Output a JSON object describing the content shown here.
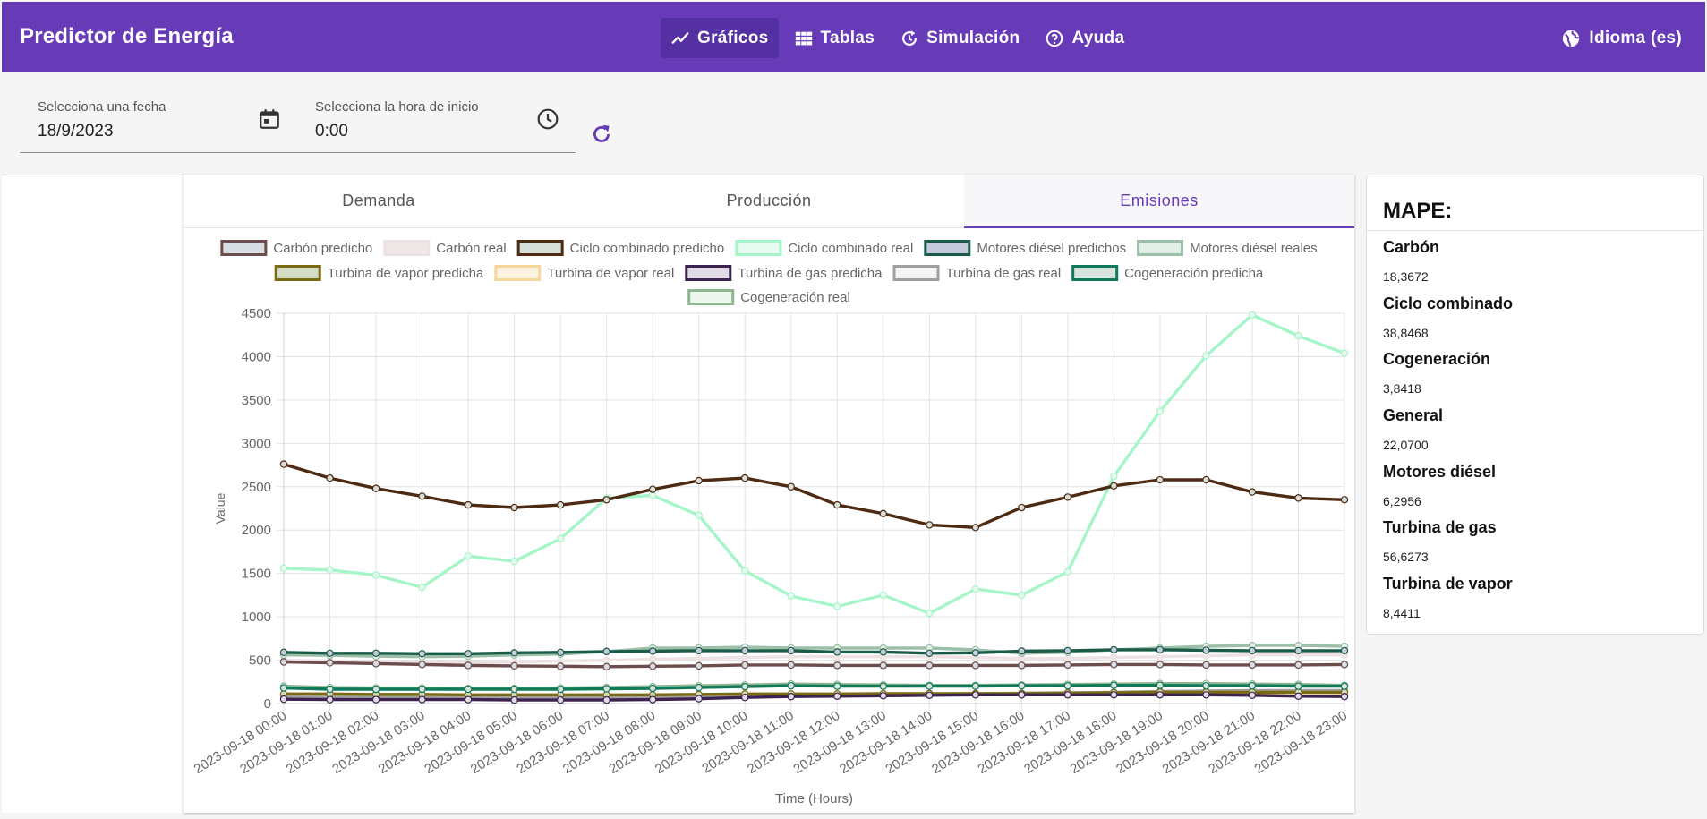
{
  "app": {
    "title": "Predictor de Energía"
  },
  "nav": [
    {
      "label": "Gráficos",
      "icon": "chart-line-icon",
      "active": true
    },
    {
      "label": "Tablas",
      "icon": "table-grid-icon",
      "active": false
    },
    {
      "label": "Simulación",
      "icon": "history-restore-icon",
      "active": false
    },
    {
      "label": "Ayuda",
      "icon": "help-circle-icon",
      "active": false
    }
  ],
  "language": {
    "label": "Idioma (es)",
    "icon": "globe-icon"
  },
  "controls": {
    "date": {
      "label": "Selecciona una fecha",
      "value": "18/9/2023",
      "icon": "calendar-icon"
    },
    "time": {
      "label": "Selecciona la hora de inicio",
      "value": "0:00",
      "icon": "clock-icon"
    },
    "refresh_icon": "refresh-icon"
  },
  "tabs": [
    {
      "label": "Demanda",
      "active": false
    },
    {
      "label": "Producción",
      "active": false
    },
    {
      "label": "Emisiones",
      "active": true
    }
  ],
  "mape": {
    "title": "MAPE:",
    "items": [
      {
        "name": "Carbón",
        "value": "18,3672"
      },
      {
        "name": "Ciclo combinado",
        "value": "38,8468"
      },
      {
        "name": "Cogeneración",
        "value": "3,8418"
      },
      {
        "name": "General",
        "value": "22,0700"
      },
      {
        "name": "Motores diésel",
        "value": "6,2956"
      },
      {
        "name": "Turbina de gas",
        "value": "56,6273"
      },
      {
        "name": "Turbina de vapor",
        "value": "8,4411"
      }
    ]
  },
  "chart_data": {
    "type": "line",
    "xlabel": "Time (Hours)",
    "ylabel": "Value",
    "ylim": [
      0,
      4500
    ],
    "yticks": [
      0,
      500,
      1000,
      1500,
      2000,
      2500,
      3000,
      3500,
      4000,
      4500
    ],
    "grid": true,
    "legend_position": "top",
    "x": [
      "2023-09-18 00:00",
      "2023-09-18 01:00",
      "2023-09-18 02:00",
      "2023-09-18 03:00",
      "2023-09-18 04:00",
      "2023-09-18 05:00",
      "2023-09-18 06:00",
      "2023-09-18 07:00",
      "2023-09-18 08:00",
      "2023-09-18 09:00",
      "2023-09-18 10:00",
      "2023-09-18 11:00",
      "2023-09-18 12:00",
      "2023-09-18 13:00",
      "2023-09-18 14:00",
      "2023-09-18 15:00",
      "2023-09-18 16:00",
      "2023-09-18 17:00",
      "2023-09-18 18:00",
      "2023-09-18 19:00",
      "2023-09-18 20:00",
      "2023-09-18 21:00",
      "2023-09-18 22:00",
      "2023-09-18 23:00"
    ],
    "series": [
      {
        "name": "Carbón predicho",
        "color": "#6d4c4c",
        "fill": "#d7dde3",
        "values": [
          480,
          470,
          460,
          450,
          440,
          435,
          430,
          425,
          430,
          435,
          445,
          445,
          440,
          440,
          440,
          440,
          440,
          445,
          450,
          450,
          445,
          445,
          445,
          450
        ]
      },
      {
        "name": "Carbón real",
        "color": "#ece1e3",
        "fill": "#efe6e8",
        "values": [
          500,
          490,
          480,
          470,
          470,
          480,
          490,
          500,
          510,
          520,
          530,
          540,
          540,
          540,
          540,
          530,
          520,
          520,
          530,
          540,
          550,
          560,
          560,
          560
        ]
      },
      {
        "name": "Ciclo combinado predicho",
        "color": "#4e2a12",
        "fill": "#d7dfd9",
        "values": [
          2760,
          2600,
          2480,
          2390,
          2290,
          2260,
          2290,
          2350,
          2470,
          2570,
          2600,
          2500,
          2290,
          2190,
          2060,
          2030,
          2260,
          2380,
          2510,
          2580,
          2580,
          2440,
          2370,
          2350
        ]
      },
      {
        "name": "Ciclo combinado real",
        "color": "#a6f5c8",
        "fill": "#e8fbf0",
        "values": [
          1560,
          1540,
          1480,
          1340,
          1700,
          1640,
          1900,
          2370,
          2400,
          2170,
          1530,
          1240,
          1120,
          1250,
          1040,
          1320,
          1250,
          1520,
          2620,
          3370,
          4010,
          4480,
          4240,
          4040
        ]
      },
      {
        "name": "Motores diésel predichos",
        "color": "#1b5c48",
        "fill": "#c5cbdc",
        "values": [
          590,
          580,
          580,
          575,
          575,
          585,
          590,
          600,
          605,
          610,
          610,
          610,
          595,
          595,
          580,
          585,
          605,
          610,
          620,
          620,
          615,
          610,
          610,
          610
        ]
      },
      {
        "name": "Motores diésel reales",
        "color": "#9bbfa9",
        "fill": "#e4efe8",
        "values": [
          560,
          555,
          545,
          540,
          545,
          560,
          570,
          600,
          640,
          640,
          650,
          640,
          640,
          640,
          640,
          620,
          580,
          590,
          620,
          640,
          660,
          670,
          670,
          660
        ]
      },
      {
        "name": "Turbina de vapor predicha",
        "color": "#7a6a12",
        "fill": "#d2dcc6",
        "values": [
          110,
          110,
          105,
          105,
          100,
          100,
          100,
          100,
          100,
          105,
          110,
          110,
          110,
          115,
          115,
          115,
          115,
          120,
          125,
          130,
          130,
          130,
          130,
          130
        ]
      },
      {
        "name": "Turbina de vapor real",
        "color": "#f5d79a",
        "fill": "#fdf3e1",
        "values": [
          100,
          100,
          95,
          95,
          90,
          90,
          90,
          95,
          95,
          100,
          105,
          105,
          105,
          110,
          110,
          110,
          110,
          115,
          120,
          125,
          125,
          125,
          125,
          125
        ]
      },
      {
        "name": "Turbina de gas predicha",
        "color": "#3d2450",
        "fill": "#e0dbe6",
        "values": [
          50,
          45,
          45,
          45,
          45,
          40,
          40,
          40,
          45,
          55,
          70,
          80,
          85,
          90,
          95,
          100,
          100,
          100,
          100,
          100,
          100,
          95,
          85,
          80
        ]
      },
      {
        "name": "Turbina de gas real",
        "color": "#a0a0a0",
        "fill": "#f4f4f4",
        "values": [
          80,
          75,
          75,
          75,
          70,
          70,
          70,
          70,
          75,
          80,
          90,
          100,
          105,
          110,
          110,
          115,
          120,
          125,
          130,
          140,
          145,
          150,
          150,
          150
        ]
      },
      {
        "name": "Cogeneración predicha",
        "color": "#0f7a5a",
        "fill": "#d8e3de",
        "values": [
          180,
          165,
          165,
          165,
          165,
          165,
          165,
          170,
          175,
          185,
          195,
          205,
          200,
          200,
          200,
          200,
          205,
          205,
          210,
          210,
          205,
          205,
          200,
          200
        ]
      },
      {
        "name": "Cogeneración real",
        "color": "#8db58f",
        "fill": "#eef6ef",
        "values": [
          200,
          185,
          180,
          180,
          175,
          175,
          180,
          185,
          195,
          205,
          215,
          225,
          220,
          215,
          210,
          210,
          215,
          220,
          225,
          230,
          230,
          225,
          220,
          210
        ]
      }
    ]
  }
}
